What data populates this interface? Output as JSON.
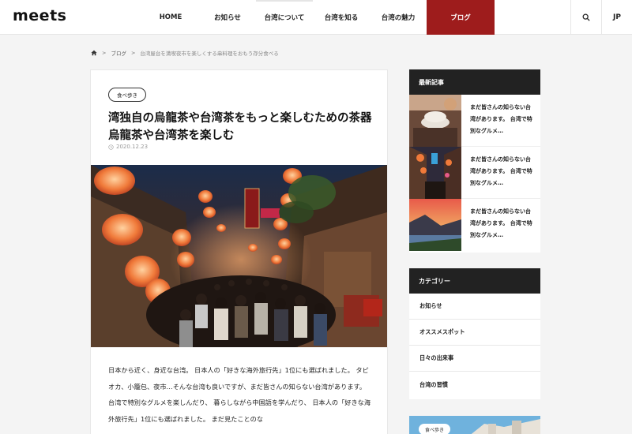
{
  "header": {
    "logo": "meets",
    "nav": [
      "HOME",
      "お知らせ",
      "台湾について",
      "台湾を知る",
      "台湾の魅力",
      "ブログ"
    ],
    "lang": "JP"
  },
  "breadcrumb": {
    "items": [
      "ブログ"
    ],
    "current": "台湾屋台を満喫夜市を楽しくする串料理をおもう存分食べる"
  },
  "article": {
    "tag": "食べ歩き",
    "title": "湾独自の烏龍茶や台湾茶をもっと楽しむための茶器烏龍茶や台湾茶を楽しむ",
    "date": "2020.12.23",
    "body": "日本から近く、身近な台湾。 日本人の「好きな海外旅行先」1位にも選ばれました。 タピオカ、小籠包、夜市…そんな台湾も良いですが、まだ皆さんの知らない台湾があります。 台湾で特別なグルメを楽しんだり、 暮らしながら中国語を学んだり、 日本人の「好きな海外旅行先」1位にも選ばれました。 まだ見たことのな"
  },
  "sidebar": {
    "recent_title": "最新記事",
    "recent": [
      {
        "text": "まだ皆さんの知らない台湾があります。 台湾で特別なグルメ…"
      },
      {
        "text": "まだ皆さんの知らない台湾があります。 台湾で特別なグルメ…"
      },
      {
        "text": "まだ皆さんの知らない台湾があります。 台湾で特別なグルメ…"
      }
    ],
    "category_title": "カテゴリー",
    "categories": [
      "お知らせ",
      "オススメスポット",
      "日々の出来事",
      "台湾の習慣"
    ],
    "promo_tag": "食べ歩き"
  },
  "colors": {
    "accent": "#9e1c1c",
    "widget_head": "#222222"
  },
  "icons": [
    "search-icon",
    "home-icon",
    "clock-icon"
  ]
}
